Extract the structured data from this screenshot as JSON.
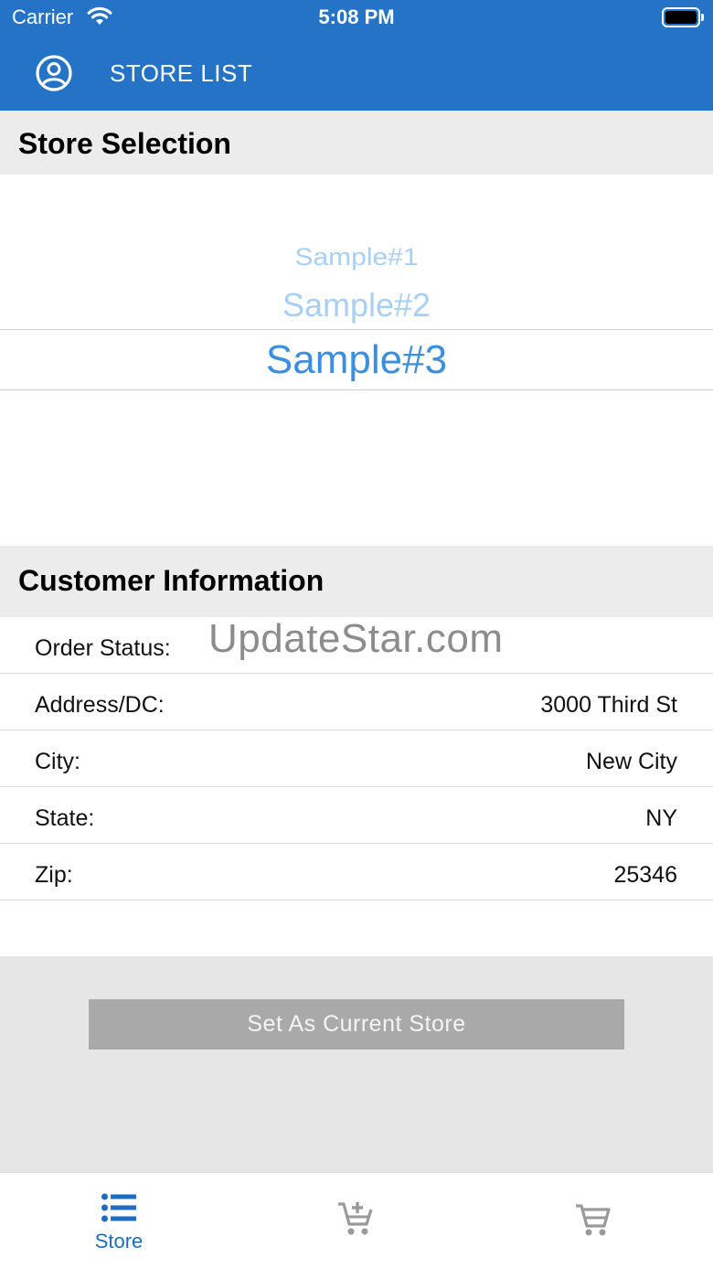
{
  "status_bar": {
    "carrier": "Carrier",
    "time": "5:08 PM"
  },
  "nav": {
    "title": "STORE LIST",
    "icon": "account-circle-icon"
  },
  "store_selection": {
    "header": "Store Selection",
    "options": [
      "Sample#1",
      "Sample#2",
      "Sample#3"
    ],
    "selected": "Sample#3"
  },
  "customer_info": {
    "header": "Customer Information",
    "rows": [
      {
        "label": "Order Status:",
        "value": ""
      },
      {
        "label": "Address/DC:",
        "value": "3000 Third St"
      },
      {
        "label": "City:",
        "value": "New City"
      },
      {
        "label": "State:",
        "value": "NY"
      },
      {
        "label": "Zip:",
        "value": "25346"
      }
    ]
  },
  "watermark": "UpdateStar.com",
  "actions": {
    "set_store_label": "Set As Current Store"
  },
  "tab_bar": {
    "tabs": [
      {
        "label": "Store",
        "icon": "list-icon",
        "active": true
      },
      {
        "label": "",
        "icon": "add-to-cart-icon",
        "active": false
      },
      {
        "label": "",
        "icon": "cart-icon",
        "active": false
      }
    ]
  },
  "colors": {
    "header_bg": "#2473c6",
    "accent": "#1c6cc3",
    "picker_selected": "#3b8fe0",
    "picker_faded": "#a8cff5",
    "button_disabled": "#a9a9a9"
  }
}
